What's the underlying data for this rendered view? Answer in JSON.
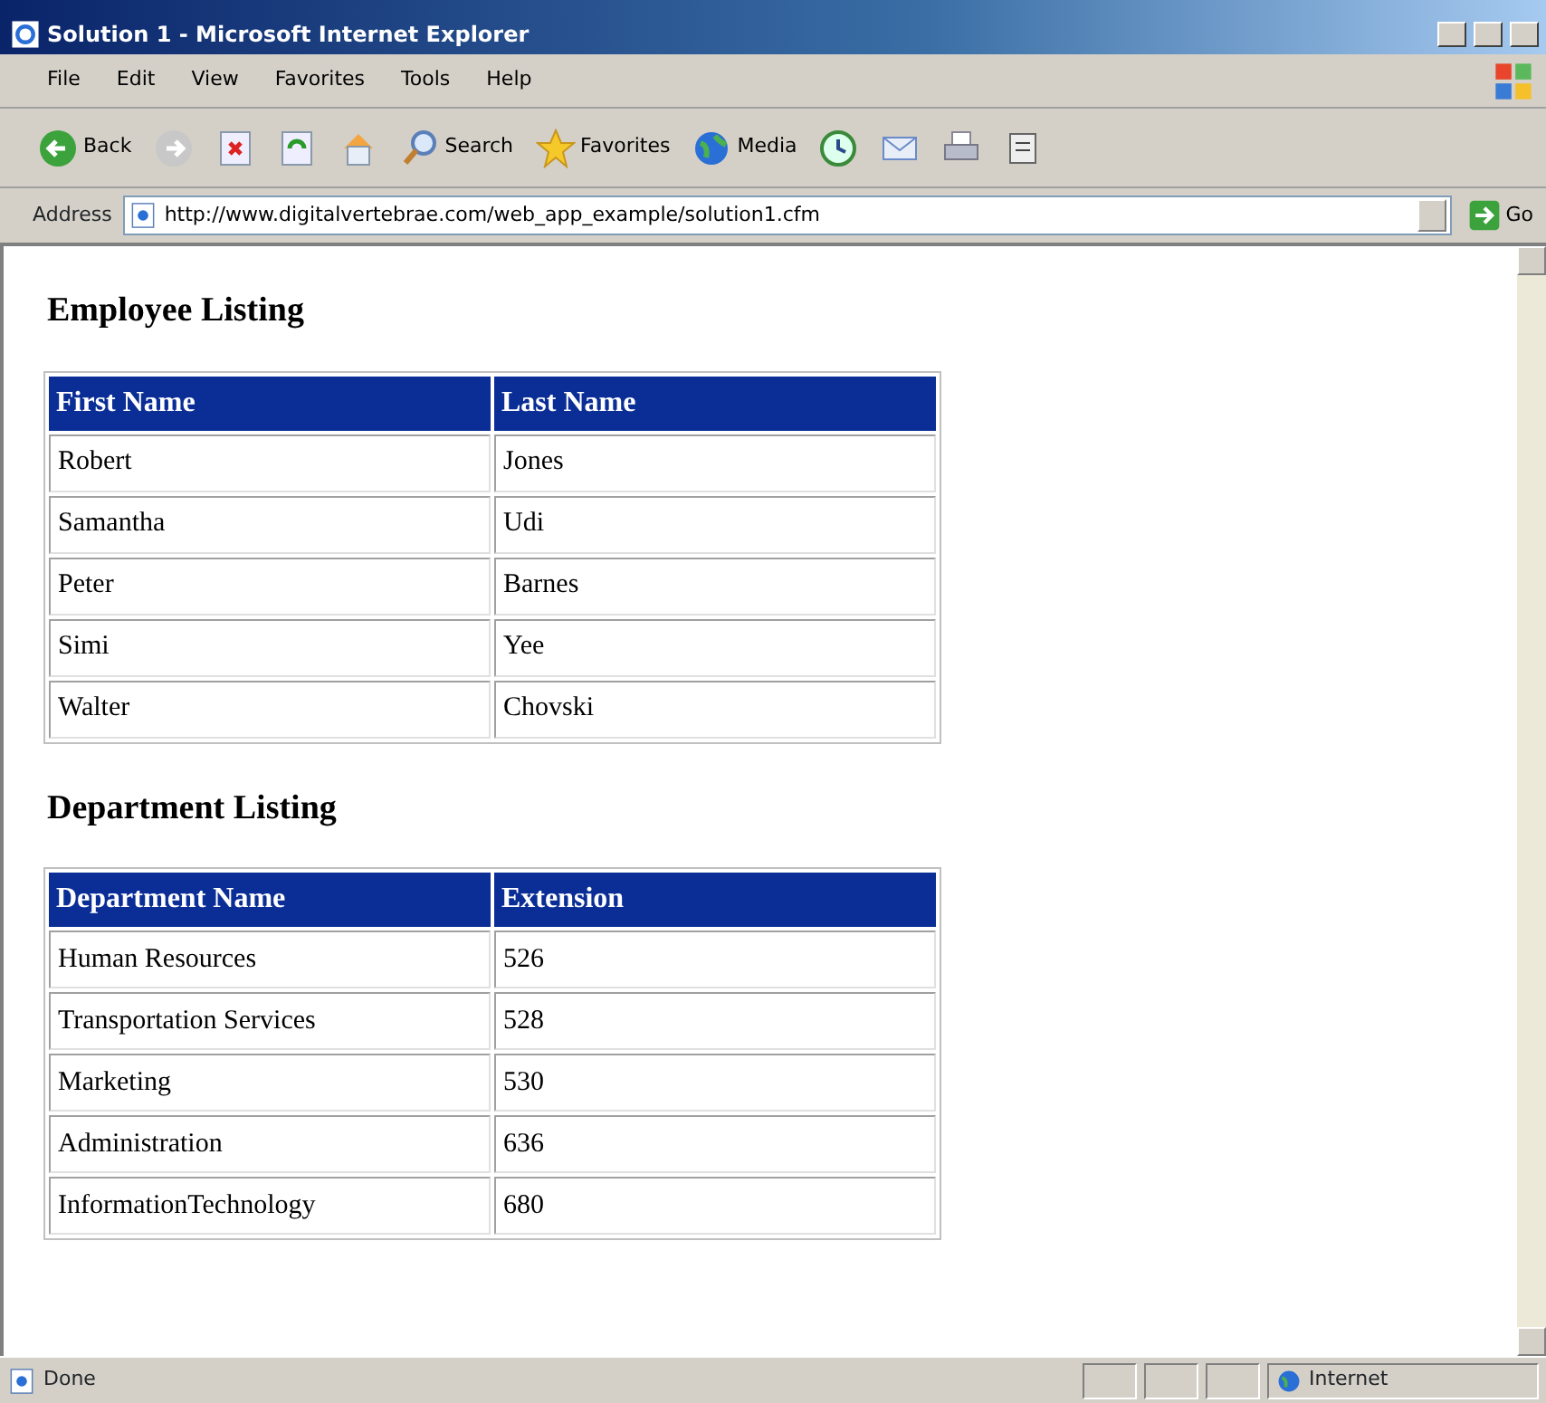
{
  "window": {
    "title": "Solution 1 - Microsoft Internet Explorer"
  },
  "menu": [
    "File",
    "Edit",
    "View",
    "Favorites",
    "Tools",
    "Help"
  ],
  "toolbar": [
    {
      "kind": "back",
      "label": "Back"
    },
    {
      "kind": "forward"
    },
    {
      "kind": "stop"
    },
    {
      "kind": "refresh"
    },
    {
      "kind": "home"
    },
    {
      "kind": "search",
      "label": "Search"
    },
    {
      "kind": "favorites",
      "label": "Favorites"
    },
    {
      "kind": "media",
      "label": "Media"
    },
    {
      "kind": "history"
    },
    {
      "kind": "mail"
    },
    {
      "kind": "print"
    },
    {
      "kind": "edit"
    }
  ],
  "address": {
    "label": "Address",
    "value": "http://www.digitalvertebrae.com/web_app_example/solution1.cfm",
    "go": "Go"
  },
  "sections": [
    {
      "heading": "Employee Listing",
      "columns": [
        "First Name",
        "Last Name"
      ],
      "rows": [
        [
          "Robert",
          "Jones"
        ],
        [
          "Samantha",
          "Udi"
        ],
        [
          "Peter",
          "Barnes"
        ],
        [
          "Simi",
          "Yee"
        ],
        [
          "Walter",
          "Chovski"
        ]
      ]
    },
    {
      "heading": "Department Listing",
      "columns": [
        "Department Name",
        "Extension"
      ],
      "rows": [
        [
          "Human Resources",
          "526"
        ],
        [
          "Transportation Services",
          "528"
        ],
        [
          "Marketing",
          "530"
        ],
        [
          "Administration",
          "636"
        ],
        [
          "InformationTechnology",
          "680"
        ]
      ]
    }
  ],
  "status_bar": {
    "text": "Done",
    "zone": "Internet"
  }
}
